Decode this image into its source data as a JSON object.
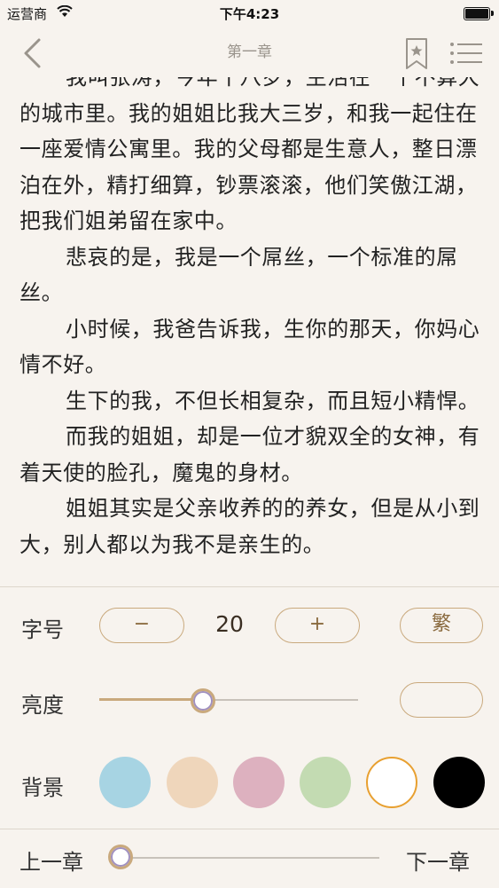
{
  "status": {
    "carrier": "运营商",
    "time": "下午4:23"
  },
  "navbar": {
    "title": "第一章",
    "back_icon": "chevron-left-icon",
    "bookmark_icon": "bookmark-star-icon",
    "menu_icon": "list-menu-icon"
  },
  "content": {
    "paragraphs": [
      {
        "text": "我叫张涛，今年十八岁，生活在一个不算大的城市里。我的姐姐比我大三岁，和我一起住在一座爱情公寓里。我的父母都是生意人，整日漂泊在外，精打细算，钞票滚滚，他们笑傲江湖，把我们姐弟留在家中。",
        "indent": true
      },
      {
        "text": "悲哀的是，我是一个屌丝，一个标准的屌丝。",
        "indent": true
      },
      {
        "text": "小时候，我爸告诉我，生你的那天，你妈心情不好。",
        "indent": true
      },
      {
        "text": "生下的我，不但长相复杂，而且短小精悍。",
        "indent": true
      },
      {
        "text": "而我的姐姐，却是一位才貌双全的女神，有着天使的脸孔，魔鬼的身材。",
        "indent": true
      },
      {
        "text": "姐姐其实是父亲收养的的养女，但是从小到大，别人都以为我不是亲生的。",
        "indent": true
      }
    ]
  },
  "settings": {
    "font_label": "字号",
    "font_decrease": "−",
    "font_size": "20",
    "font_increase": "+",
    "traditional_label": "繁",
    "brightness_label": "亮度",
    "brightness_level": 0.4,
    "night_icon": "moon-icon",
    "background_label": "背景",
    "backgrounds": [
      {
        "name": "blue",
        "color": "#a7d4e3"
      },
      {
        "name": "beige",
        "color": "#efd6bb"
      },
      {
        "name": "pink",
        "color": "#ddb1bf"
      },
      {
        "name": "green",
        "color": "#c3dbb2"
      },
      {
        "name": "white",
        "color": "#ffffff",
        "selected": true
      },
      {
        "name": "black",
        "color": "#000000"
      }
    ],
    "prev_chapter": "上一章",
    "next_chapter": "下一章",
    "chapter_progress": 0.0,
    "accent_color": "#c9a97d"
  }
}
